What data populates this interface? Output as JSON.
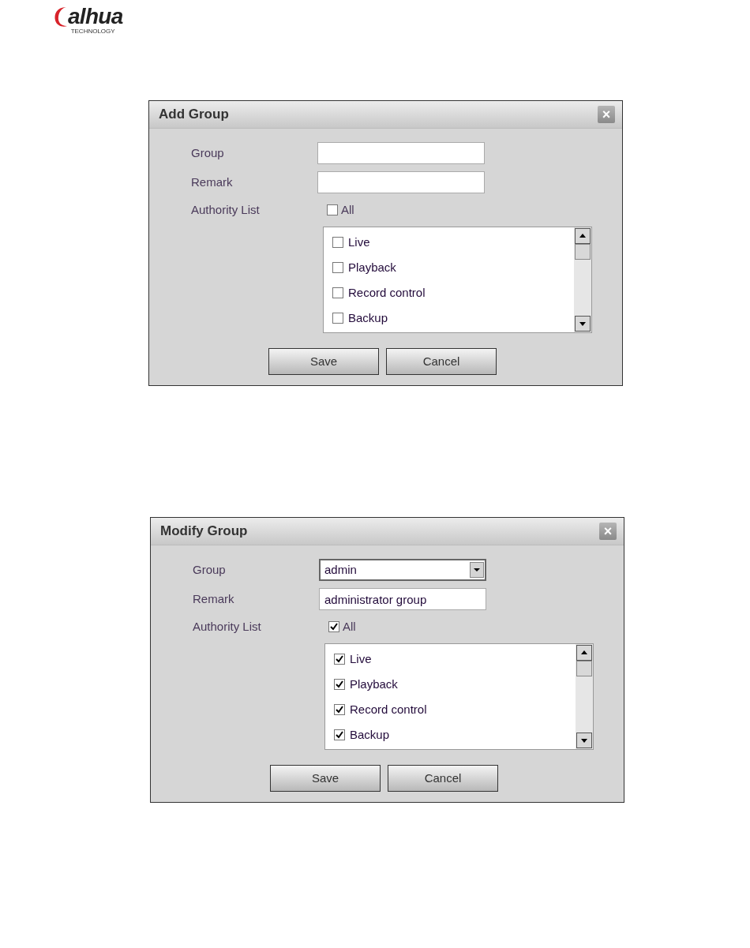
{
  "logo": {
    "name": "alhua",
    "tagline": "TECHNOLOGY"
  },
  "dialogs": [
    {
      "title": "Add Group",
      "close": "×",
      "fields": [
        {
          "label": "Group",
          "kind": "text"
        },
        {
          "label": "Remark",
          "kind": "text"
        }
      ],
      "authority": {
        "label": "Authority List",
        "all": {
          "label": "All",
          "checked": false
        },
        "items": [
          {
            "label": "Live",
            "checked": false
          },
          {
            "label": "Playback",
            "checked": false
          },
          {
            "label": "Record control",
            "checked": false
          },
          {
            "label": "Backup",
            "checked": false
          }
        ]
      },
      "buttons": [
        "Save",
        "Cancel"
      ]
    },
    {
      "title": "Modify Group",
      "close": "×",
      "fields": [
        {
          "label": "Group",
          "kind": "select",
          "value": "admin"
        },
        {
          "label": "Remark",
          "kind": "text",
          "value": "administrator group"
        }
      ],
      "authority": {
        "label": "Authority List",
        "all": {
          "label": "All",
          "checked": true
        },
        "items": [
          {
            "label": "Live",
            "checked": true
          },
          {
            "label": "Playback",
            "checked": true
          },
          {
            "label": "Record control",
            "checked": true
          },
          {
            "label": "Backup",
            "checked": true
          }
        ]
      },
      "buttons": [
        "Save",
        "Cancel"
      ]
    }
  ]
}
